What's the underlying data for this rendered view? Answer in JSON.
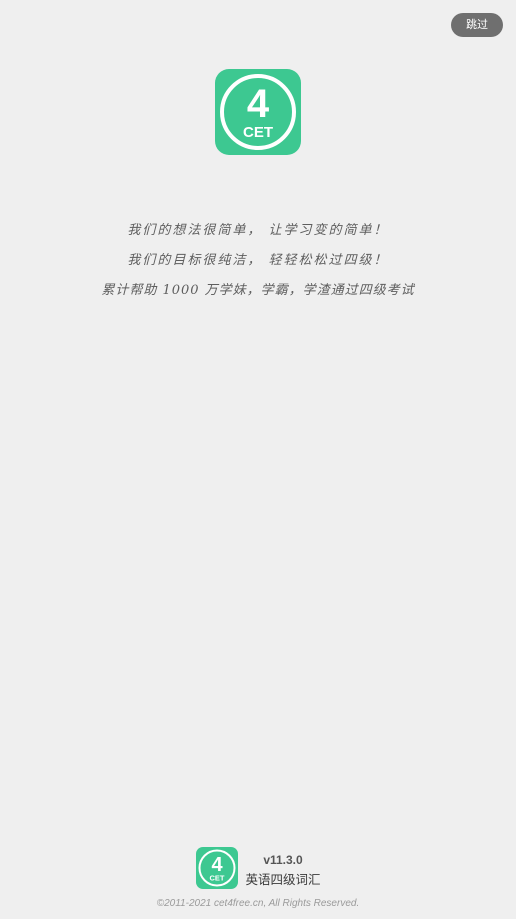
{
  "header": {
    "skip_label": "跳过"
  },
  "logo": {
    "number": "4",
    "text": "CET",
    "color": "#3dc891"
  },
  "slogans": [
    "我们的想法很简单， 让学习变的简单！",
    "我们的目标很纯洁， 轻轻松松过四级！",
    "累计帮助 1000 万学妹，学霸，学渣通过四级考试"
  ],
  "footer": {
    "version": "v11.3.0",
    "app_name": "英语四级词汇",
    "copyright": "©2011-2021 cet4free.cn, All Rights Reserved."
  }
}
